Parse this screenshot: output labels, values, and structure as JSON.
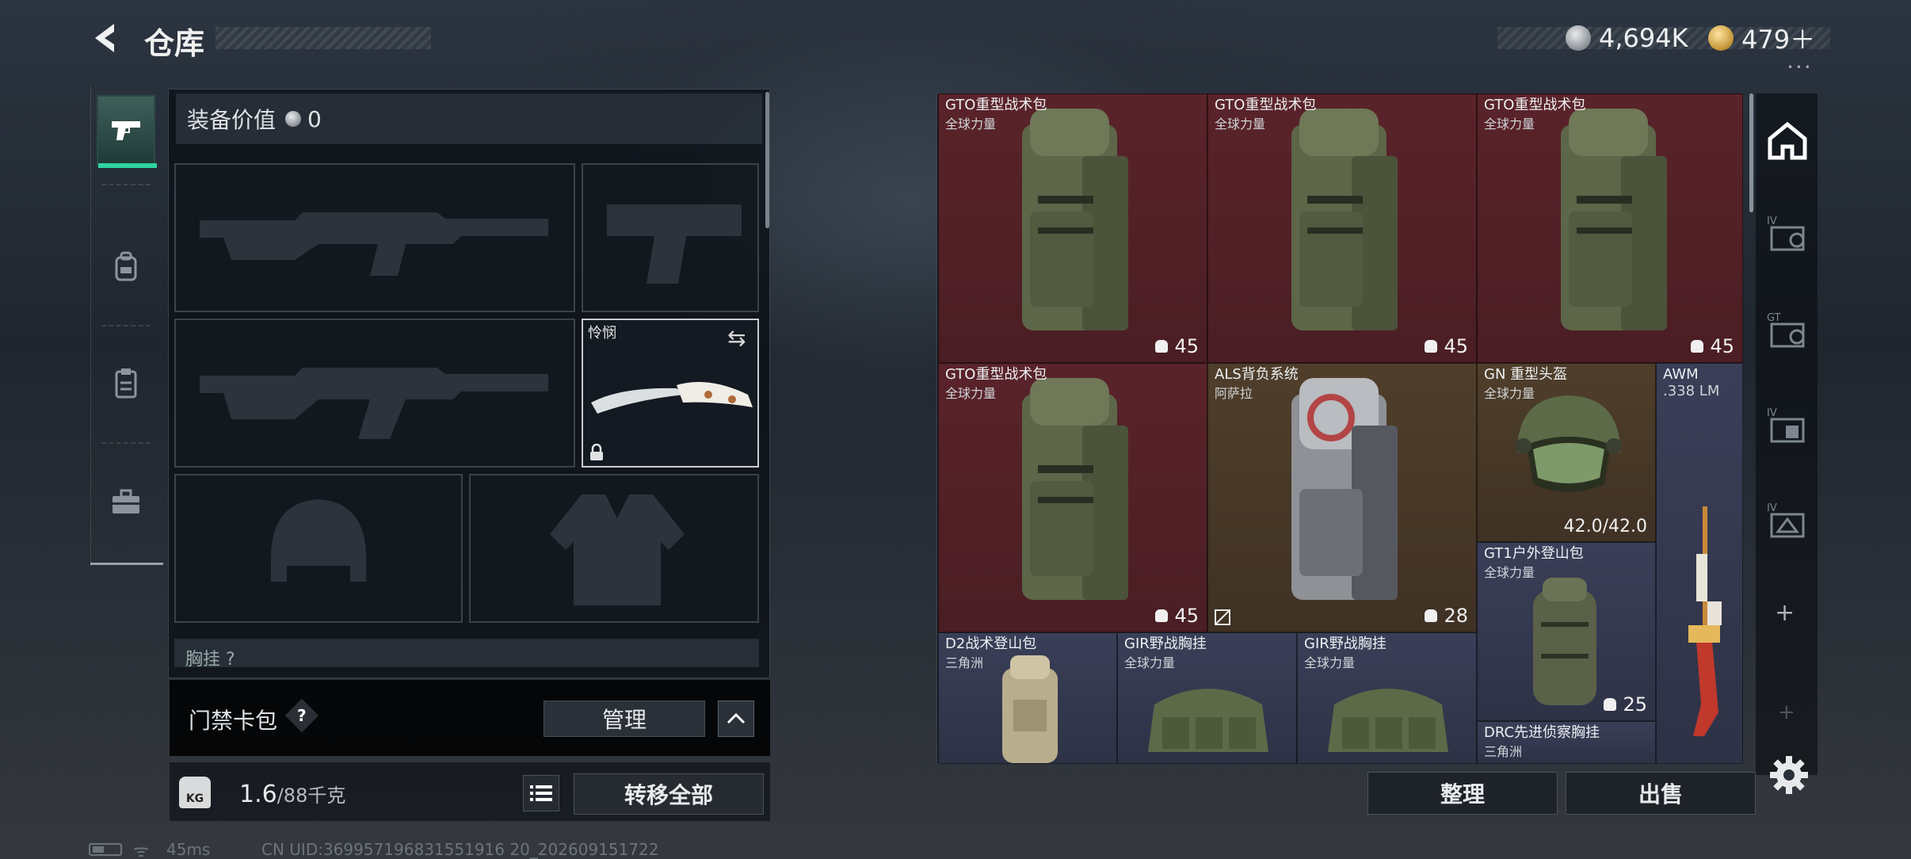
{
  "header": {
    "title": "仓库"
  },
  "currency": {
    "silver": "4,694K",
    "gold": "479＋",
    "silver_icon": "silver-coin-icon",
    "gold_icon": "gold-coin-icon"
  },
  "sidebar": {
    "tabs": [
      {
        "name": "weapons",
        "icon": "pistol-icon",
        "active": true
      },
      {
        "name": "gear",
        "icon": "backpack-icon"
      },
      {
        "name": "consumables",
        "icon": "clipboard-icon"
      },
      {
        "name": "tools",
        "icon": "toolbox-icon"
      }
    ]
  },
  "loadout": {
    "equip_value_label": "装备价值",
    "equip_value": "0",
    "melee_label": "怜悯",
    "chest_label": "胸挂 ?"
  },
  "keycard": {
    "label": "门禁卡包",
    "help": "?",
    "manage": "管理"
  },
  "weight": {
    "current": "1.6",
    "max": "/88千克",
    "kg_label": "KG",
    "transfer": "转移全部"
  },
  "statusbar": {
    "ping": "45ms",
    "uid": "CN UID:369957196831551916 20_202609151722"
  },
  "storage": {
    "accent_colors": {
      "red": "#5a232a",
      "brown": "#4f3e2a",
      "slate": "#3a3f58"
    },
    "items": [
      {
        "name": "GTO重型战术包",
        "sub": "全球力量",
        "cap": "45"
      },
      {
        "name": "GTO重型战术包",
        "sub": "全球力量",
        "cap": "45"
      },
      {
        "name": "GTO重型战术包",
        "sub": "全球力量",
        "cap": "45"
      },
      {
        "name": "GTO重型战术包",
        "sub": "全球力量",
        "cap": "45"
      },
      {
        "name": "ALS背负系统",
        "sub": "阿萨拉",
        "cap": "28"
      },
      {
        "name": "GN 重型头盔",
        "sub": "全球力量",
        "durability": "42.0/42.0"
      },
      {
        "name": "AWM",
        "sub": ".338 LM"
      },
      {
        "name": "GT1户外登山包",
        "sub": "全球力量",
        "cap": "25"
      },
      {
        "name": "D2战术登山包",
        "sub": "三角洲"
      },
      {
        "name": "GIR野战胸挂",
        "sub": "全球力量"
      },
      {
        "name": "GIR野战胸挂",
        "sub": "全球力量"
      },
      {
        "name": "DRC先进侦察胸挂",
        "sub": "三角洲"
      }
    ]
  },
  "right_tabs": [
    "IV",
    "GT",
    "IV",
    "IV"
  ],
  "actions": {
    "sort": "整理",
    "sell": "出售",
    "plus": "+"
  }
}
